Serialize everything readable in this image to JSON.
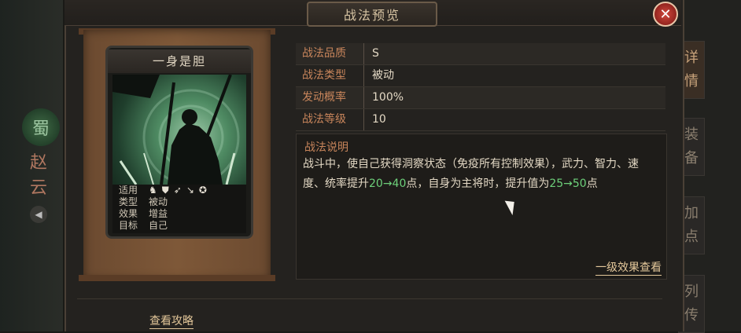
{
  "dialog": {
    "title": "战法预览",
    "close_label": "✕"
  },
  "side": {
    "faction": "蜀",
    "hero_name": "赵云",
    "sound_icon": "speaker-icon",
    "tabs": [
      {
        "label": "详情",
        "active": true
      },
      {
        "label": "装备",
        "active": false
      },
      {
        "label": "加点",
        "active": false
      },
      {
        "label": "列传",
        "active": false
      }
    ]
  },
  "skill_card": {
    "name": "一身是胆",
    "props": {
      "applicable_label": "适用",
      "type_label": "类型",
      "type_value": "被动",
      "effect_label": "效果",
      "effect_value": "增益",
      "target_label": "目标",
      "target_value": "自己",
      "troop_icons": [
        "cavalry-icon",
        "shield-icon",
        "bow-icon",
        "spear-icon",
        "wheel-icon"
      ]
    }
  },
  "attributes": [
    {
      "label": "战法品质",
      "value": "S"
    },
    {
      "label": "战法类型",
      "value": "被动"
    },
    {
      "label": "发动概率",
      "value": "100%"
    },
    {
      "label": "战法等级",
      "value": "10"
    }
  ],
  "description": {
    "title": "战法说明",
    "text_1": "战斗中，使自己获得洞察状态（免疫所有控制效果），武力、智力、速度、统率提升",
    "hl_1": "20→40",
    "text_2": "点，自身为主将时，提升值为",
    "hl_2": "25→50",
    "text_3": "点",
    "level_link": "一级效果查看"
  },
  "footer": {
    "guide_link": "查看攻略"
  },
  "colors": {
    "label": "#c8855b",
    "highlight": "#6dd07a",
    "link": "#e3c79a",
    "close": "#d2493e"
  }
}
